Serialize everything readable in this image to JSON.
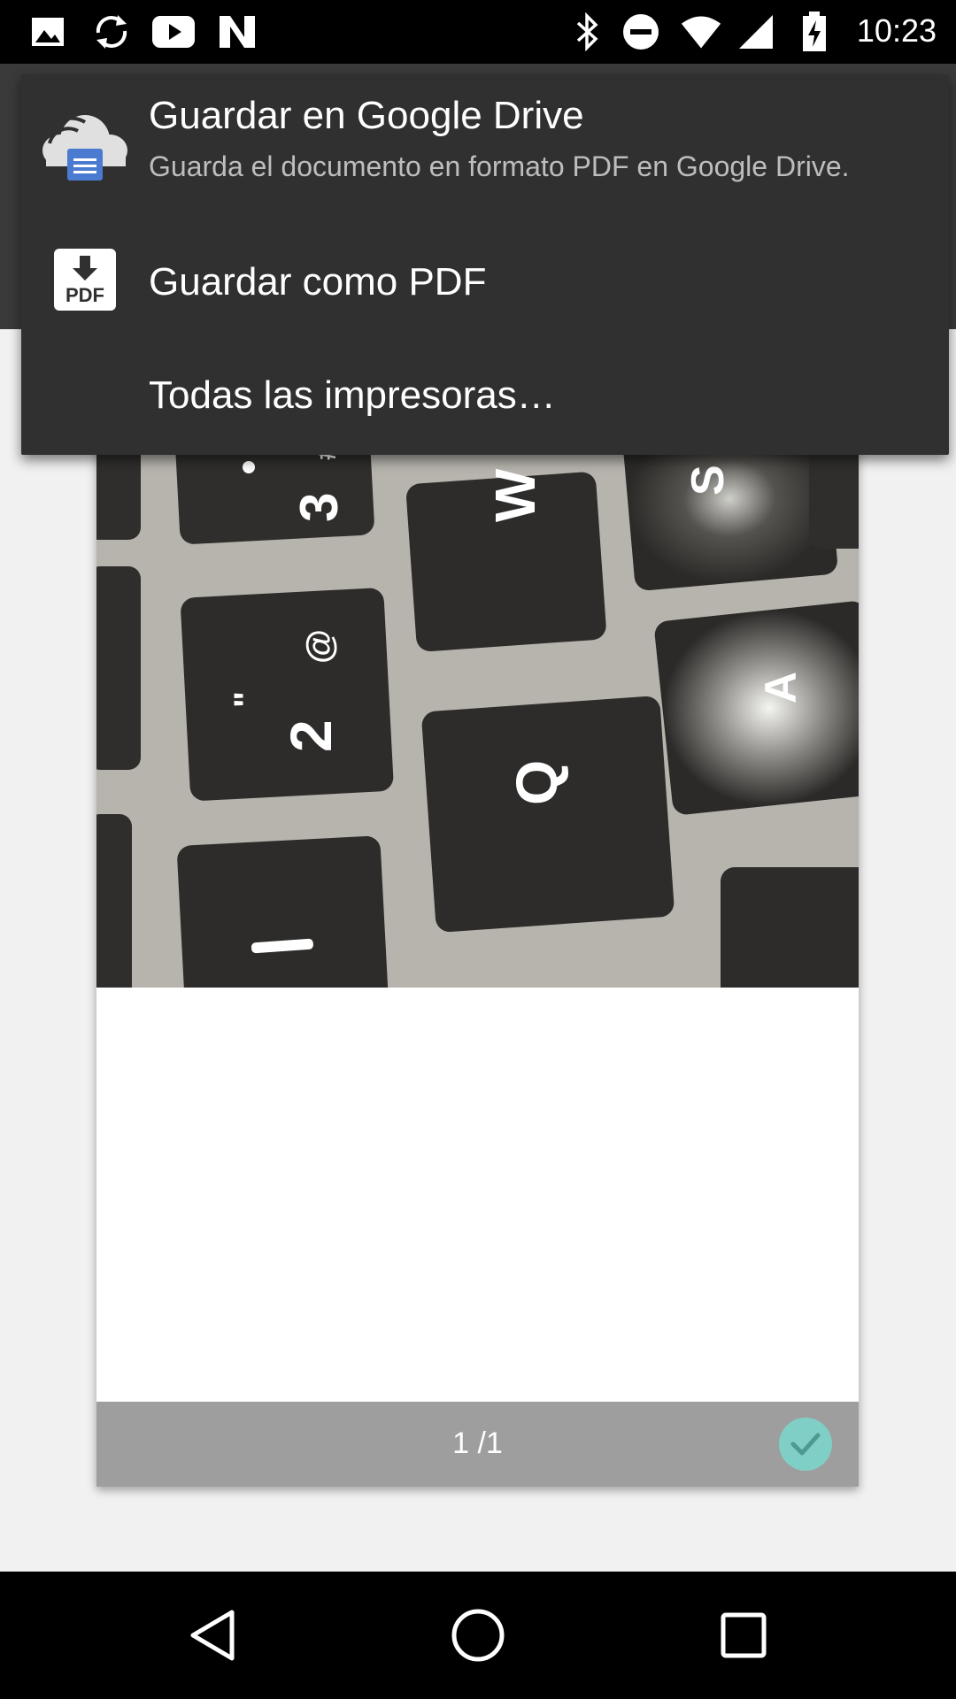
{
  "status_bar": {
    "time": "10:23",
    "left_icons": [
      "image-icon",
      "sync-icon",
      "youtube-icon",
      "n-logo-icon"
    ],
    "right_icons": [
      "bluetooth-icon",
      "do-not-disturb-icon",
      "wifi-icon",
      "cell-signal-icon",
      "battery-charging-icon"
    ]
  },
  "menu": {
    "items": [
      {
        "title": "Guardar en Google Drive",
        "subtitle": "Guarda el documento en formato PDF en Google Drive.",
        "icon": "google-drive-cloud-icon"
      },
      {
        "title": "Guardar como PDF",
        "icon": "pdf-download-icon"
      },
      {
        "title": "Todas las impresoras…"
      }
    ]
  },
  "preview": {
    "page_indicator": "1 /1",
    "selected": true,
    "colors": {
      "footer": "#9e9e9e",
      "check": "#7fcfc6"
    }
  },
  "nav_bar": {
    "buttons": [
      "back-icon",
      "home-icon",
      "recents-icon"
    ]
  }
}
